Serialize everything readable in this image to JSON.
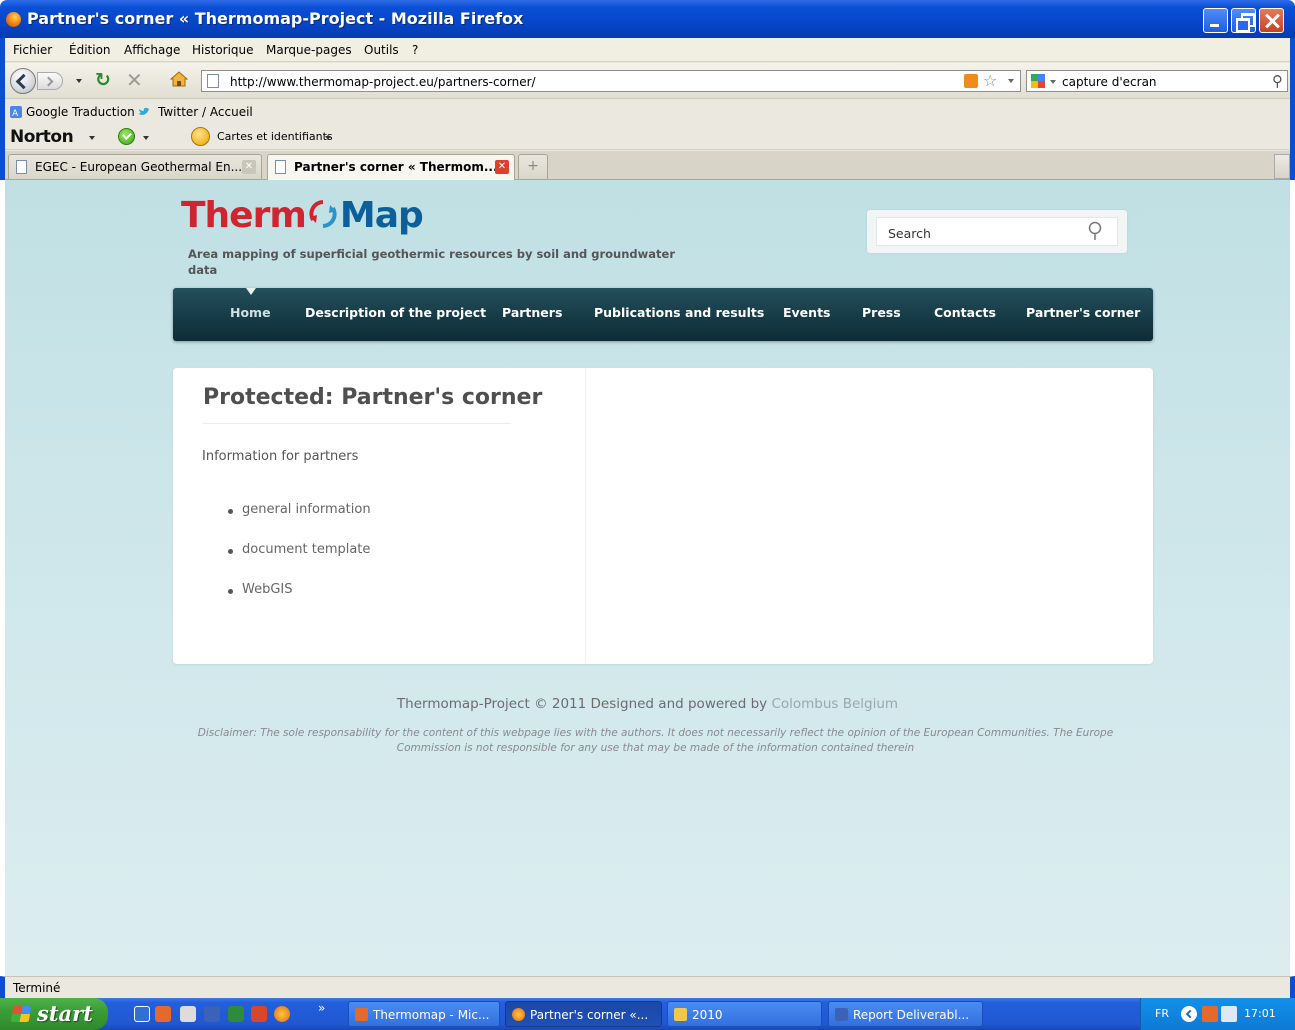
{
  "window": {
    "title": "Partner's corner « Thermomap-Project - Mozilla Firefox"
  },
  "menubar": [
    "Fichier",
    "Édition",
    "Affichage",
    "Historique",
    "Marque-pages",
    "Outils",
    "?"
  ],
  "navigation": {
    "url": "http://www.thermomap-project.eu/partners-corner/",
    "search_engine_icon": "google-icon",
    "search_value": "capture d'ecran"
  },
  "bookmarks": [
    {
      "label": "Google Traduction",
      "icon": "google-translate-icon"
    },
    {
      "label": "Twitter / Accueil",
      "icon": "twitter-bird-icon"
    }
  ],
  "norton": {
    "logo": "Norton",
    "cards_label": "Cartes et identifiants"
  },
  "tabs": [
    {
      "label": "EGEC - European Geothermal En...",
      "active": false
    },
    {
      "label": "Partner's corner « Thermom...",
      "active": true
    }
  ],
  "site": {
    "logo_left": "Therm",
    "logo_right": "Map",
    "tagline": "Area mapping of superficial geothermic resources by soil and groundwater data",
    "search_placeholder": "Search",
    "nav": [
      "Home",
      "Description of the project",
      "Partners",
      "Publications and results",
      "Events",
      "Press",
      "Contacts",
      "Partner's corner"
    ],
    "active_nav": "Home",
    "colors": {
      "logo_red": "#cf2530",
      "logo_blue": "#0c5f99",
      "nav_bg": "#173d48"
    }
  },
  "page": {
    "heading": "Protected: Partner's corner",
    "intro": "Information for partners",
    "links": [
      "general information",
      "document template",
      "WebGIS"
    ]
  },
  "footer": {
    "copyright": "Thermomap-Project © 2011 Designed and powered by ",
    "company": "Colombus Belgium",
    "disclaimer_line1": "Disclaimer: The sole responsability for the content of this webpage lies with the authors. It does not necessarily reflect the opinion of the European Communities. The Europe",
    "disclaimer_line2": "Commission is not responsible for any use that may be made of the information contained therein"
  },
  "status": "Terminé",
  "taskbar": {
    "start": "start",
    "tasks": [
      {
        "label": "Thermomap - Mic...",
        "active": false
      },
      {
        "label": "Partner's corner «...",
        "active": true
      },
      {
        "label": "2010",
        "active": false
      },
      {
        "label": "Report Deliverabl...",
        "active": false
      }
    ],
    "language": "FR",
    "time": "17:01"
  }
}
